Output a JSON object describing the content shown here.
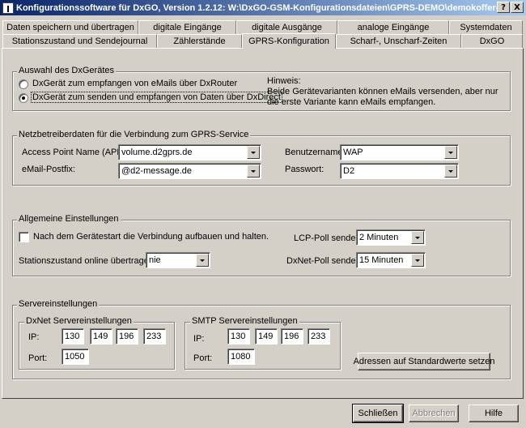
{
  "window": {
    "title": "Konfigurationssoftware für DxGO, Version 1.2.12:   W:\\DxGO-GSM-Konfigurationsdateien\\GPRS-DEMO\\demokoffer-gpr...",
    "help_button": "?",
    "close_button": "X"
  },
  "tabs_row1": [
    {
      "label": "Daten speichern und übertragen"
    },
    {
      "label": "digitale Eingänge"
    },
    {
      "label": "digitale Ausgänge"
    },
    {
      "label": "analoge Eingänge"
    },
    {
      "label": "Systemdaten"
    }
  ],
  "tabs_row2": [
    {
      "label": "Stationszustand und Sendejournal"
    },
    {
      "label": "Zählerstände"
    },
    {
      "label": "GPRS-Konfiguration"
    },
    {
      "label": "Scharf-, Unscharf-Zeiten"
    },
    {
      "label": "DxGO"
    }
  ],
  "device_group": {
    "legend": "Auswahl des DxGerätes",
    "option1": "DxGerät zum empfangen von eMails über DxRouter",
    "option2": "DxGerät zum senden und empfangen von Daten über DxDirect",
    "selected": 2,
    "hint": "Hinweis:\nBeide Gerätevarianten können eMails versenden, aber nur die erste Variante kann eMails empfangen."
  },
  "network_group": {
    "legend": "Netzbetreiberdaten für die Verbindung zum GPRS-Service",
    "apn_label": "Access Point Name  (APN):",
    "apn_value": "volume.d2gprs.de",
    "mailbox_label": "eMail-Postfix:",
    "mailbox_value": "@d2-message.de",
    "user_label": "Benutzername:",
    "user_value": "WAP",
    "password_label": "Passwort:",
    "password_value": "D2"
  },
  "general_group": {
    "legend": "Allgemeine Einstellungen",
    "autoconnect_label": "Nach dem Gerätestart die Verbindung aufbauen und halten.",
    "autoconnect_checked": false,
    "station_online_label": "Stationszustand online übertragen:",
    "station_online_value": "nie",
    "lcp_label": "LCP-Poll senden:",
    "lcp_value": "2 Minuten",
    "dxnet_label": "DxNet-Poll senden:",
    "dxnet_value": "15 Minuten"
  },
  "server_group": {
    "legend": "Servereinstellungen",
    "dxnet": {
      "legend": "DxNet Servereinstellungen",
      "ip_label": "IP:",
      "ip": [
        "130",
        "149",
        "196",
        "233"
      ],
      "port_label": "Port:",
      "port": "1050"
    },
    "smtp": {
      "legend": "SMTP Servereinstellungen",
      "ip_label": "IP:",
      "ip": [
        "130",
        "149",
        "196",
        "233"
      ],
      "port_label": "Port:",
      "port": "1080"
    },
    "reset_button": "Adressen auf Standardwerte setzen"
  },
  "footer": {
    "close": "Schließen",
    "cancel": "Abbrechen",
    "help": "Hilfe"
  }
}
